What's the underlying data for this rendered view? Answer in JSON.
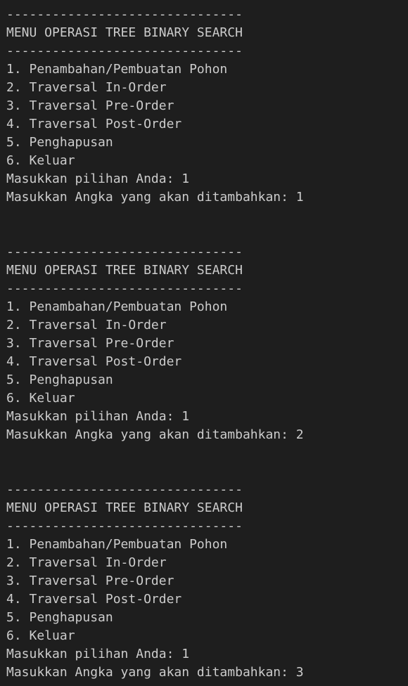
{
  "blocks": [
    {
      "separator_top": "-------------------------------",
      "title": "MENU OPERASI TREE BINARY SEARCH",
      "separator_bottom": "-------------------------------",
      "options": [
        "1. Penambahan/Pembuatan Pohon",
        "2. Traversal In-Order",
        "3. Traversal Pre-Order",
        "4. Traversal Post-Order",
        "5. Penghapusan",
        "6. Keluar"
      ],
      "choice_prompt": "Masukkan pilihan Anda: 1",
      "number_prompt": "Masukkan Angka yang akan ditambahkan: 1"
    },
    {
      "separator_top": "-------------------------------",
      "title": "MENU OPERASI TREE BINARY SEARCH",
      "separator_bottom": "-------------------------------",
      "options": [
        "1. Penambahan/Pembuatan Pohon",
        "2. Traversal In-Order",
        "3. Traversal Pre-Order",
        "4. Traversal Post-Order",
        "5. Penghapusan",
        "6. Keluar"
      ],
      "choice_prompt": "Masukkan pilihan Anda: 1",
      "number_prompt": "Masukkan Angka yang akan ditambahkan: 2"
    },
    {
      "separator_top": "-------------------------------",
      "title": "MENU OPERASI TREE BINARY SEARCH",
      "separator_bottom": "-------------------------------",
      "options": [
        "1. Penambahan/Pembuatan Pohon",
        "2. Traversal In-Order",
        "3. Traversal Pre-Order",
        "4. Traversal Post-Order",
        "5. Penghapusan",
        "6. Keluar"
      ],
      "choice_prompt": "Masukkan pilihan Anda: 1",
      "number_prompt": "Masukkan Angka yang akan ditambahkan: 3"
    }
  ],
  "colors": {
    "background": "#1e1e1e",
    "text": "#cccccc"
  }
}
